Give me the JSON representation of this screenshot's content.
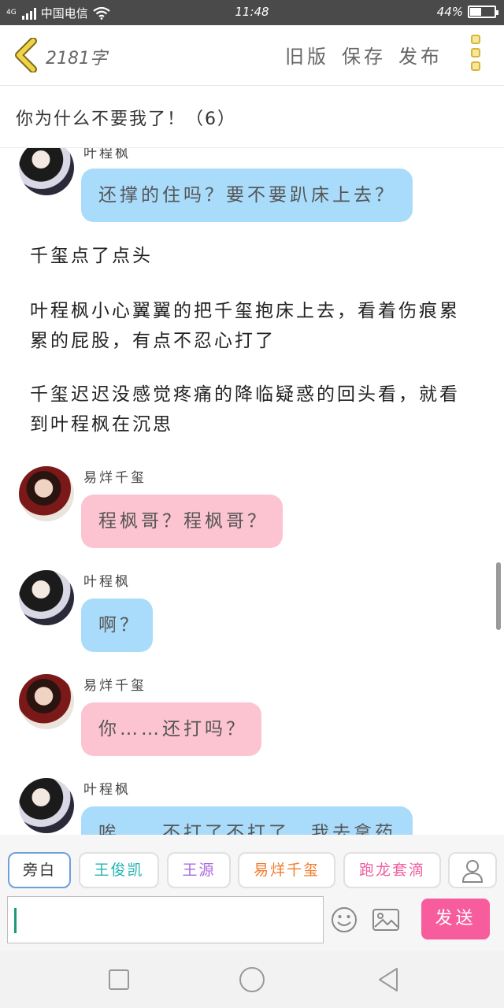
{
  "status": {
    "network_small": "4G",
    "carrier": "中国电信",
    "time": "11:48",
    "battery_text": "44%",
    "battery_level": 0.44
  },
  "header": {
    "word_count": "2181字",
    "old_version": "旧版",
    "save": "保存",
    "publish": "发布"
  },
  "title": "你为什么不要我了！（6）",
  "messages": [
    {
      "speaker": "叶程枫",
      "text": "还撑的住吗？要不要趴床上去？"
    },
    {
      "narration": "千玺点了点头"
    },
    {
      "narration": "叶程枫小心翼翼的把千玺抱床上去，看着伤痕累累的屁股，有点不忍心打了"
    },
    {
      "narration": "千玺迟迟没感觉疼痛的降临疑惑的回头看，就看到叶程枫在沉思"
    },
    {
      "speaker": "易烊千玺",
      "text": "程枫哥？程枫哥？"
    },
    {
      "speaker": "叶程枫",
      "text": "啊？"
    },
    {
      "speaker": "易烊千玺",
      "text": "你……还打吗？"
    },
    {
      "speaker": "叶程枫",
      "text": "唉……不打了不打了，我去拿药"
    }
  ],
  "characters": [
    {
      "label": "旁白"
    },
    {
      "label": "王俊凯"
    },
    {
      "label": "王源"
    },
    {
      "label": "易烊千玺"
    },
    {
      "label": "跑龙套滴"
    }
  ],
  "composer": {
    "value": "",
    "placeholder": "",
    "send": "发送"
  },
  "colors": {
    "blue_bubble": "#a9dcfb",
    "pink_bubble": "#fcc3d1",
    "send_button": "#f75d9d",
    "menu_icon": "#d9b43a"
  }
}
